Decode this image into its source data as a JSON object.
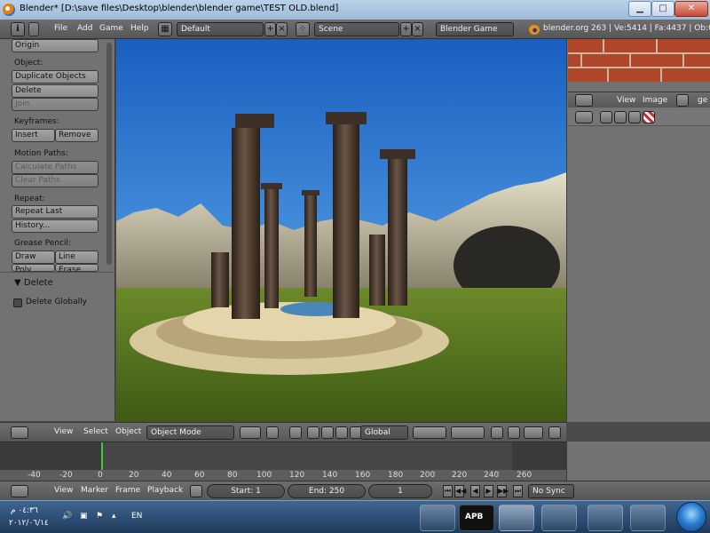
{
  "titlebar": {
    "title": "Blender* [D:\\save files\\Desktop\\blender\\blender game\\TEST OLD.blend]",
    "minimize_glyph": "▁",
    "maximize_glyph": "□",
    "close_glyph": "✕"
  },
  "info_header": {
    "menus": [
      "File",
      "Add",
      "Game",
      "Help"
    ],
    "screen_layout": "Default",
    "scene": "Scene",
    "render_engine": "Blender Game",
    "stats": "blender.org 263 | Ve:5414 | Fa:4437 | Ob:0-41"
  },
  "tool_shelf": {
    "origin_button": "Origin",
    "object_section": "Object:",
    "duplicate_objects": "Duplicate Objects",
    "delete": "Delete",
    "join": "Join",
    "keyframes_section": "Keyframes:",
    "insert": "Insert",
    "remove": "Remove",
    "motion_paths_section": "Motion Paths:",
    "calculate_paths": "Calculate Paths",
    "clear_paths": "Clear Paths",
    "repeat_section": "Repeat:",
    "repeat_last": "Repeat Last",
    "history": "History...",
    "grease_pencil_section": "Grease Pencil:",
    "draw": "Draw",
    "line": "Line",
    "poly": "Poly",
    "erase": "Erase"
  },
  "operator_panel": {
    "title": "▼ Delete",
    "delete_globally": "Delete Globally"
  },
  "image_editor_header": {
    "view": "View",
    "image": "Image",
    "image_name": "ge"
  },
  "view3d_header": {
    "view": "View",
    "select": "Select",
    "object": "Object",
    "mode": "Object Mode",
    "orientation": "Global"
  },
  "timeline": {
    "ticks": [
      "-40",
      "-20",
      "0",
      "20",
      "40",
      "60",
      "80",
      "100",
      "120",
      "140",
      "160",
      "180",
      "200",
      "220",
      "240",
      "260"
    ],
    "current_frame_marker": 0
  },
  "timeline_header": {
    "view": "View",
    "marker": "Marker",
    "frame": "Frame",
    "playback": "Playback",
    "start": "Start: 1",
    "end": "End: 250",
    "current": "1",
    "sync": "No Sync"
  },
  "taskbar": {
    "clock_time": "٠٤:٣٦ م",
    "clock_date": "٢٠١٢/٠٦/١٤",
    "language": "EN",
    "apb_label": "APB"
  },
  "colors": {
    "sky": "#3a7fd0",
    "grass": "#5a7a20",
    "blender_panel": "#727272",
    "timeline_frame": "#3ec83e"
  }
}
